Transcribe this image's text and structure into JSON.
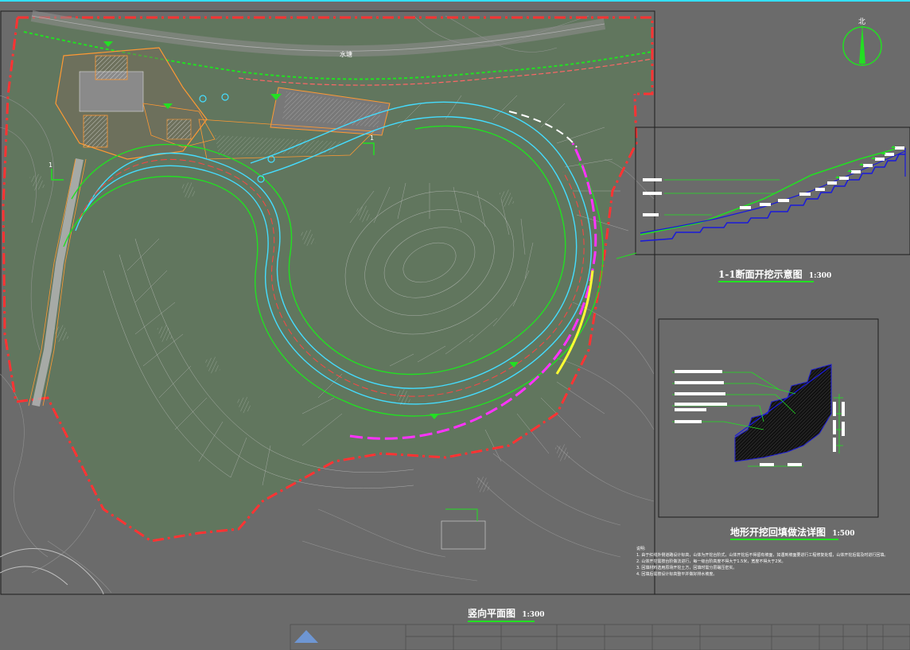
{
  "plan": {
    "title": "竖向平面图",
    "scale": "1:300",
    "north_label": "北",
    "lake_label": "水塘",
    "section_mark": "1"
  },
  "section_view": {
    "title": "1-1断面开挖示意图",
    "scale": "1:300"
  },
  "detail_view": {
    "title": "地形开挖回填做法详图",
    "scale": "1:500"
  },
  "notes": {
    "heading": "说明:",
    "items": [
      "1. 由于红线外侧道路设计标高，山体为开挖台阶式，山体开挖后不得留有坡面，如遇到坡面要进行工程修复处理，山体开挖后需及时进行回填。",
      "2. 山体开挖需按台阶做法进行，每一级台阶高度不得大于1.5米，宽度不得大于2米。",
      "3. 回填材料选用原场开挖土方，回填时需分层碾压密实。",
      "4. 回填后需按设计标高整平并做好排水坡度。"
    ]
  },
  "colors": {
    "background": "#6b6b6b",
    "frame": "#1e1e1e",
    "red_boundary": "#ff3333",
    "green": "#22e022",
    "cyan": "#44ddff",
    "blue": "#1a1adb",
    "magenta": "#ff33ff",
    "yellow": "#ffff33",
    "orange": "#ff9933"
  }
}
